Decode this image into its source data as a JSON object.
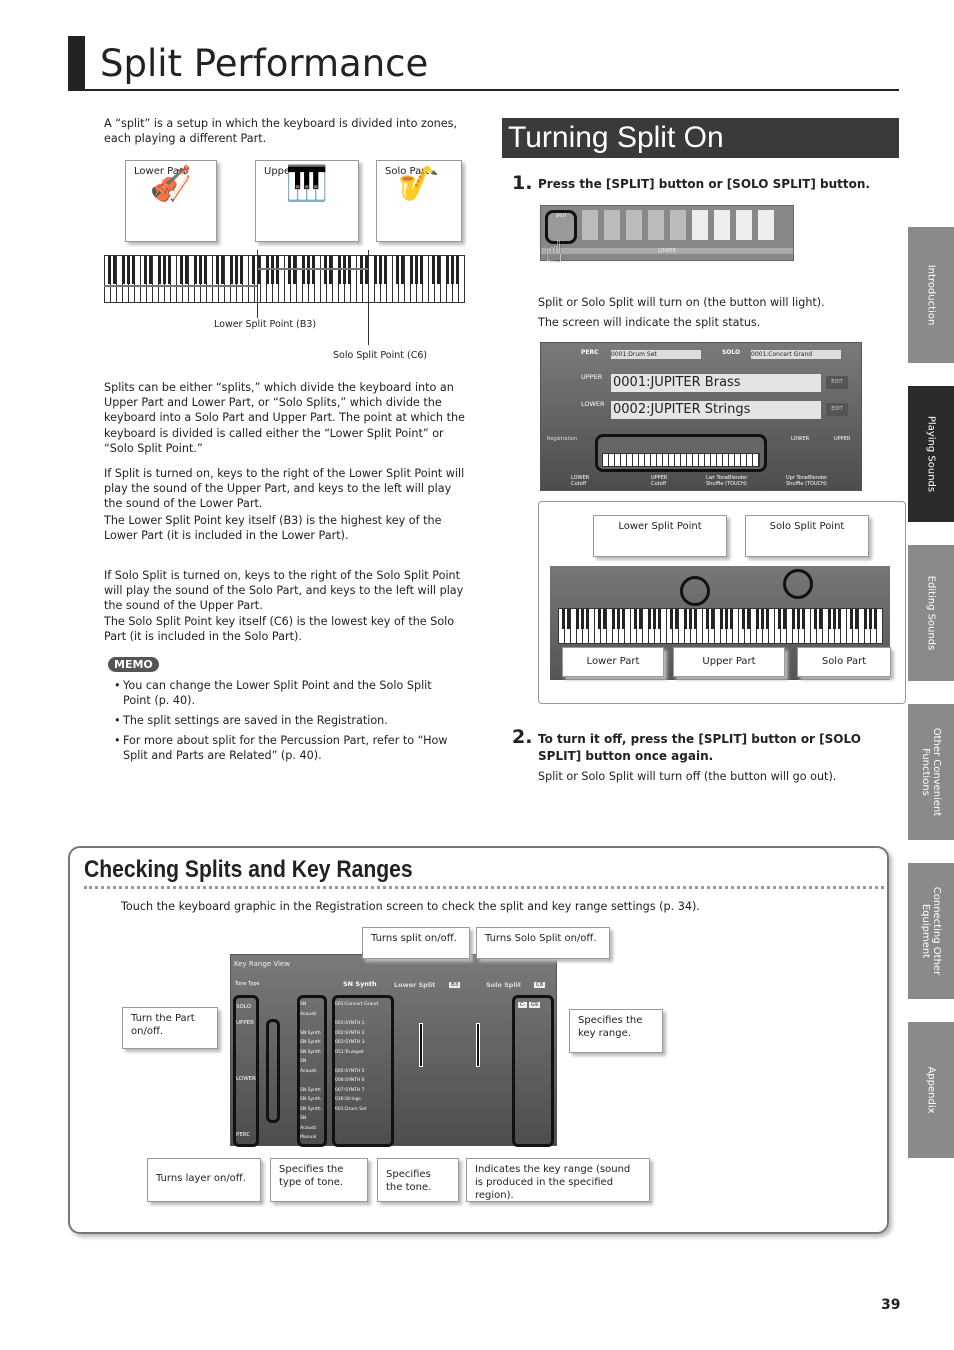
{
  "header": {
    "title": "Split Performance"
  },
  "intro": "A “split” is a setup in which the keyboard is divided into zones, each playing a different Part.",
  "diagram": {
    "lower_part": "Lower Part",
    "upper_part": "Upper Part",
    "solo_part": "Solo Part",
    "lower_split_point": "Lower Split Point (B3)",
    "solo_split_point": "Solo Split Point (C6)"
  },
  "paragraphs": [
    "Splits can be either “splits,” which divide the keyboard into an Upper Part and Lower Part, or “Solo Splits,” which divide the keyboard into a Solo Part and Upper Part. The point at which the keyboard is divided is called either the “Lower Split Point” or “Solo Split Point.”",
    "If Split is turned on, keys to the right of the Lower Split Point will play the sound of the Upper Part, and keys to the left will play the sound of the Lower Part.",
    "The Lower Split Point key itself (B3) is the highest key of the Lower Part (it is included in the Lower Part).",
    "If Solo Split is turned on, keys to the right of the Solo Split Point will play the sound of the Solo Part, and keys to the left will play the sound of the Upper Part.",
    "The Solo Split Point key itself (C6) is the lowest key of the Solo Part (it is included in the Solo Part)."
  ],
  "memo": {
    "label": "MEMO",
    "items": [
      "You can change the Lower Split Point and the Solo Split Point (p. 40).",
      "The split settings are saved in the Registration.",
      "For more about split for the Percussion Part, refer to “How Split and Parts are Related” (p. 40)."
    ]
  },
  "turn_on": {
    "title": "Turning Split On",
    "step1": {
      "num": "1.",
      "text": "Press the [SPLIT] button or [SOLO SPLIT] button."
    },
    "panel": {
      "buttons": [
        "SPLIT",
        "BASS",
        "E.PIANO",
        "CHOIR",
        "STRINGS",
        "SYNTH STRINGS",
        "BRASS/ SAX",
        "SYNTH BRASS",
        "WOOD WINDS",
        "OTHER"
      ],
      "lower": "LOWER"
    },
    "after1": "Split or Solo Split will turn on (the button will light).",
    "after2": "The screen will indicate the split status.",
    "screen": {
      "perc": "PERC",
      "perc_tone": "0001:Drum Set",
      "solo": "SOLO",
      "solo_tone": "0001:Concert Grand",
      "upper": "UPPER",
      "upper_tone": "0001:JUPITER Brass",
      "lower": "LOWER",
      "lower_tone": "0002:JUPITER Strings",
      "edit": "EDIT",
      "registration": "Registration",
      "lower_cutoff": "LOWER Cutoff",
      "upper_cutoff": "UPPER Cutoff",
      "lwr_blender": "Lwr ToneBlender Shuffle (TOUCH)",
      "upr_blender": "Upr ToneBlender Shuffle (TOUCH)",
      "lower_label": "LOWER",
      "upper_label": "UPPER"
    },
    "zoom": {
      "lower_split_point": "Lower Split Point",
      "solo_split_point": "Solo Split Point",
      "lower_part": "Lower Part",
      "upper_part": "Upper Part",
      "solo_part": "Solo Part"
    },
    "step2": {
      "num": "2.",
      "text": "To turn it off, press the [SPLIT] button or [SOLO SPLIT] button once again."
    },
    "after3": "Split or Solo Split will turn off (the button will go out)."
  },
  "checking": {
    "title": "Checking Splits and Key Ranges",
    "intro": "Touch the keyboard graphic in the Registration screen to check the split and key range settings (p. 34).",
    "callouts": {
      "split": "Turns split on/off.",
      "solo_split": "Turns Solo Split on/off.",
      "part": "Turn the Part on/off.",
      "key_range": "Specifies the key range.",
      "layer": "Turns layer on/off.",
      "tone_type": "Specifies the type of tone.",
      "tone": "Specifies the tone.",
      "indicates": "Indicates the key range (sound is produced in the specified region)."
    },
    "screen": {
      "title": "Key Range View",
      "tone_type": "Tone Type",
      "sn_synth": "SN Synth",
      "lower_split": "Lower Split",
      "lower_point": "B3",
      "solo_split": "Solo Split",
      "solo_point": "C6",
      "parts": [
        "SOLO",
        "UPPER",
        "LOWER",
        "PERC"
      ],
      "types": [
        "SN Acousti",
        "SN Synth",
        "SN Synth",
        "SN Synth",
        "SN Acousti",
        "SN Synth",
        "SN Synth",
        "SN Synth",
        "SN Acousti",
        "Manual Perc"
      ],
      "tones": [
        "001:Concert Grand",
        "001:SYNTH 1",
        "002:SYNTH 2",
        "003:SYNTH 3",
        "051:Trumpet",
        "005:SYNTH 5",
        "006:SYNTH 6",
        "007:SYNTH 7",
        "036:Strings",
        "001:Drum Set"
      ],
      "lower": "C-",
      "upper": "G9"
    }
  },
  "sidebar": [
    {
      "label": "Introduction",
      "active": false
    },
    {
      "label": "Playing Sounds",
      "active": true
    },
    {
      "label": "Editing Sounds",
      "active": false
    },
    {
      "label": "Other Convenient Functions",
      "active": false
    },
    {
      "label": "Connecting Other Equipment",
      "active": false
    },
    {
      "label": "Appendix",
      "active": false
    }
  ],
  "page_number": "39"
}
